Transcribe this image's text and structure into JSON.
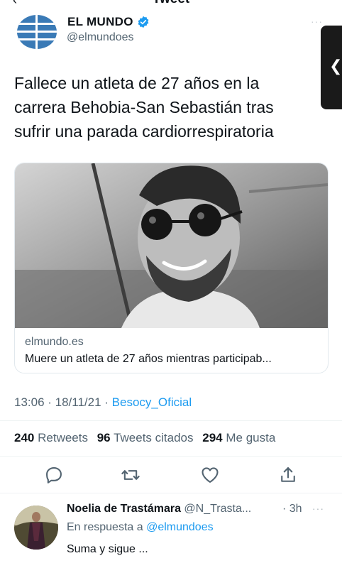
{
  "header": {
    "title": "Tweet",
    "back_icon": "chevron-left-icon"
  },
  "tweet": {
    "author_name": "EL MUNDO",
    "author_handle": "@elmundoes",
    "verified": true,
    "text": "Fallece un atleta de 27 años en la carrera Behobia-San Sebastián tras sufrir una parada cardiorrespiratoria",
    "card": {
      "domain": "elmundo.es",
      "title": "Muere un atleta de 27 años mientras participab..."
    },
    "time": "13:06 · 18/11/21 · ",
    "source": "Besocy_Oficial",
    "stats": {
      "retweets_count": "240",
      "retweets_label": "Retweets",
      "quotes_count": "96",
      "quotes_label": "Tweets citados",
      "likes_count": "294",
      "likes_label": "Me gusta"
    },
    "actions": [
      "reply-icon",
      "retweet-icon",
      "like-icon",
      "share-icon"
    ]
  },
  "reply": {
    "name": "Noelia de Trastámara",
    "handle": "@N_Trasta...",
    "time": "· 3h",
    "in_reply_prefix": "En respuesta a ",
    "in_reply_mention": "@elmundoes",
    "text": "Suma y sigue ..."
  },
  "colors": {
    "link": "#1d9bf0",
    "secondary": "#536471",
    "verified": "#1d9bf0"
  }
}
